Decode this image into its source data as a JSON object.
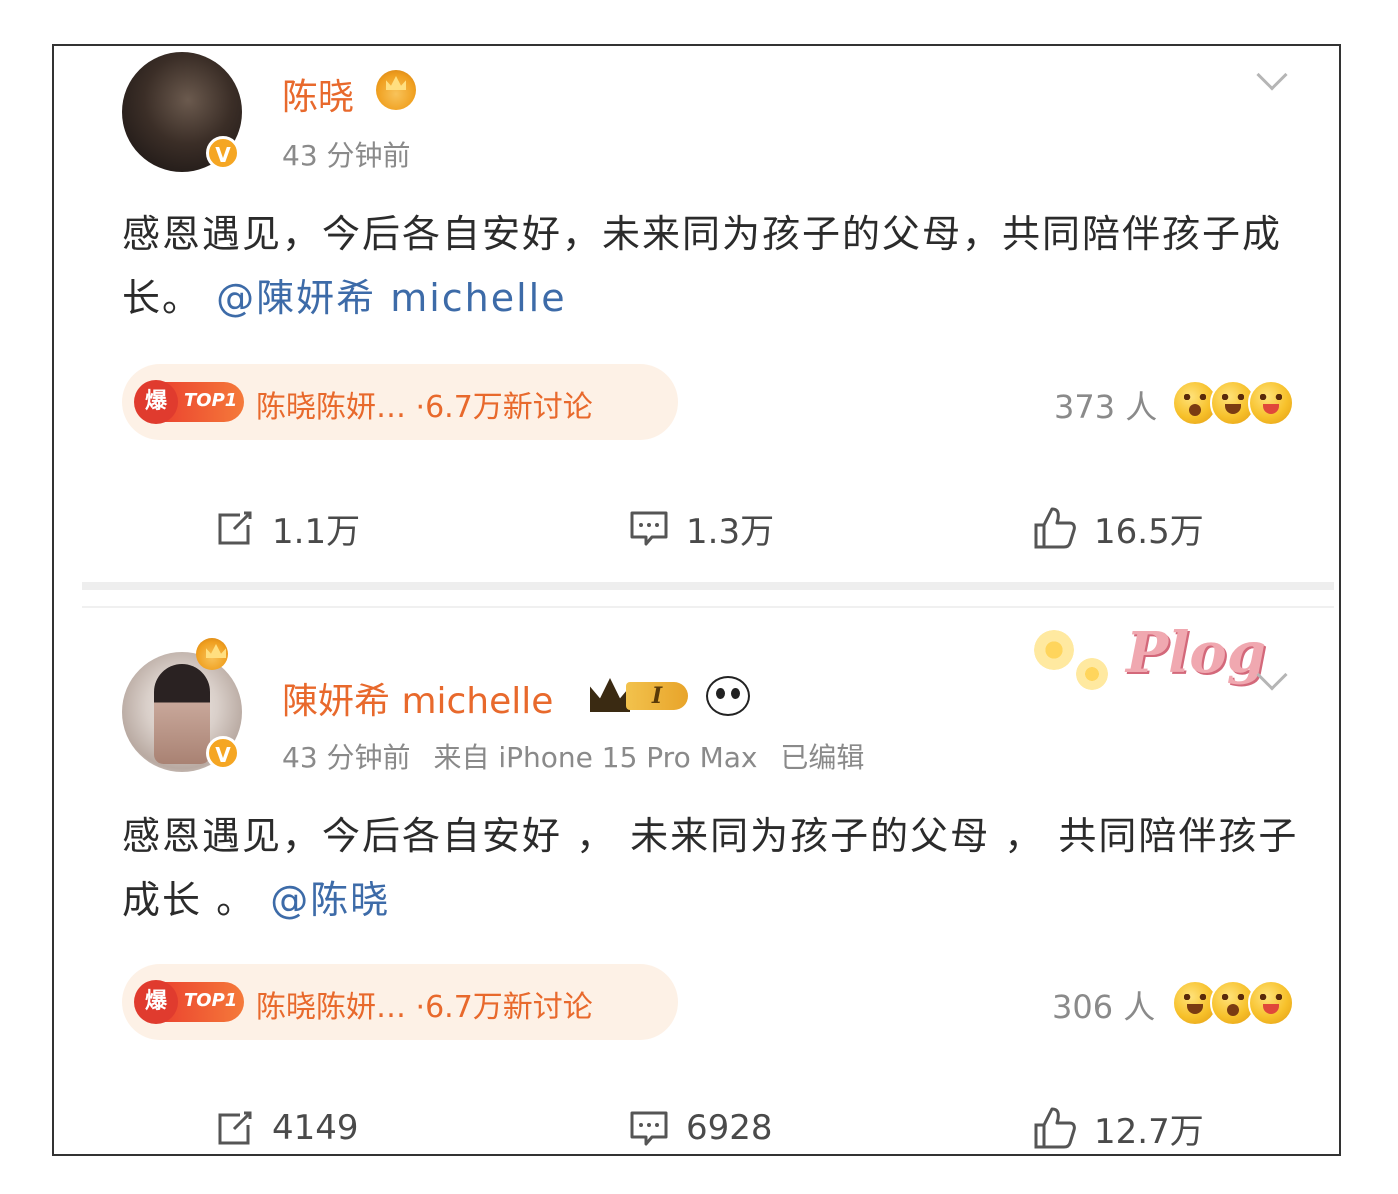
{
  "posts": [
    {
      "name": "陈晓",
      "time": "43 分钟前",
      "source": "",
      "edited": "",
      "text": "感恩遇见，今后各自安好，未来同为孩子的父母，共同陪伴孩子成长。",
      "mention": "@陳妍希 michelle",
      "topic": {
        "tag": "TOP1",
        "flame": "爆",
        "title": "陈晓陈妍…",
        "discussion": "·6.7万新讨论"
      },
      "reactions": "373 人",
      "actions": {
        "repost": "1.1万",
        "comment": "1.3万",
        "like": "16.5万"
      }
    },
    {
      "name": "陳妍希 michelle",
      "time": "43 分钟前",
      "source": "来自 iPhone 15 Pro Max",
      "edited": "已编辑",
      "text": "感恩遇见，今后各自安好 ， 未来同为孩子的父母 ， 共同陪伴孩子成长 。",
      "mention": "@陈晓",
      "level_badge": "I",
      "topic": {
        "tag": "TOP1",
        "flame": "爆",
        "title": "陈晓陈妍…",
        "discussion": "·6.7万新讨论"
      },
      "reactions": "306 人",
      "actions": {
        "repost": "4149",
        "comment": "6928",
        "like": "12.7万"
      }
    }
  ],
  "decorations": {
    "plog": "Plog"
  },
  "colors": {
    "name": "#e8692c",
    "mention": "#3d6ba8",
    "meta": "#8a8a8a",
    "pill_bg": "#fdf1e6"
  }
}
